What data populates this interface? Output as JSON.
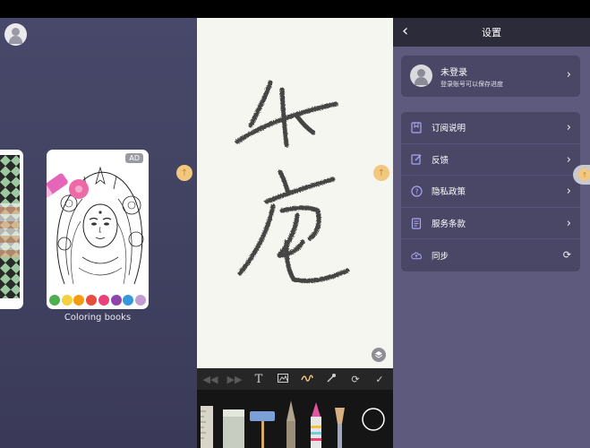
{
  "left_panel": {
    "ad_badge": "AD",
    "card_caption": "Coloring books",
    "swatch_colors": [
      "#4caf50",
      "#f4d03f",
      "#f39c12",
      "#e74c3c",
      "#ec407a",
      "#8e44ad",
      "#3498db",
      "#c39bd3"
    ]
  },
  "canvas_toolbar": {
    "icons": [
      "undo-icon",
      "redo-icon",
      "text-icon",
      "image-icon",
      "brush-icon",
      "eyedropper-icon",
      "rotate-icon",
      "check-icon"
    ]
  },
  "settings": {
    "title": "设置",
    "login": {
      "name": "未登录",
      "subtitle": "登录账号可以保存进度"
    },
    "items": [
      {
        "label": "订阅说明",
        "icon": "bookmark-icon",
        "action": "chevron"
      },
      {
        "label": "反馈",
        "icon": "edit-icon",
        "action": "chevron"
      },
      {
        "label": "隐私政策",
        "icon": "help-icon",
        "action": "chevron"
      },
      {
        "label": "服务条款",
        "icon": "document-icon",
        "action": "chevron"
      },
      {
        "label": "同步",
        "icon": "cloud-icon",
        "action": "sync"
      }
    ]
  },
  "colors": {
    "accent_gold": "#f2c77e",
    "settings_bg": "#5d5a7e",
    "settings_card": "#4a4766"
  }
}
